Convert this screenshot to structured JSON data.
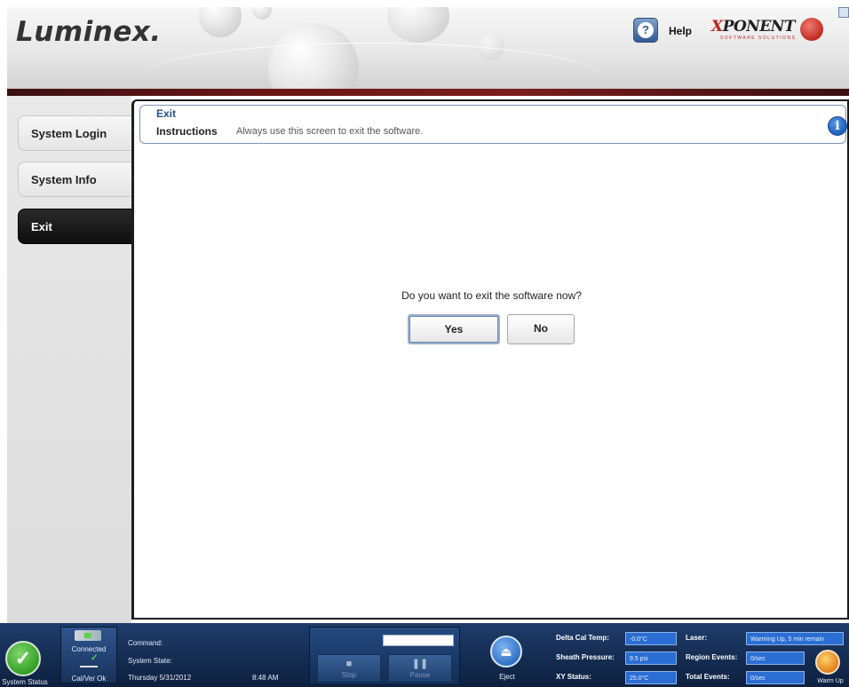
{
  "header": {
    "logo": "Luminex",
    "logo_dot": ".",
    "help_label": "Help",
    "help_icon": "?",
    "brand_word": "XPONENT",
    "brand_sub": "SOFTWARE SOLUTIONS"
  },
  "sidebar": {
    "items": [
      {
        "label": "System Login",
        "active": false
      },
      {
        "label": "System Info",
        "active": false
      },
      {
        "label": "Exit",
        "active": true
      }
    ]
  },
  "main": {
    "section_title": "Exit",
    "instructions_label": "Instructions",
    "instructions_text": "Always use this screen to exit the software.",
    "info_icon": "i",
    "question": "Do you want to exit the software now?",
    "yes_label": "Yes",
    "no_label": "No"
  },
  "statusbar": {
    "system_status_label": "System Status",
    "connected_label": "Connected",
    "calver_label": "Cal/Ver Ok",
    "command_label": "Command:",
    "system_state_label": "System State:",
    "date": "Thursday 5/31/2012",
    "time": "8:48 AM",
    "stop_label": "Stop",
    "pause_label": "Pause",
    "eject_label": "Eject",
    "warmup_label": "Warm Up",
    "readouts": {
      "delta_cal_temp": {
        "label": "Delta Cal Temp:",
        "value": "-0.0°C"
      },
      "sheath_pressure": {
        "label": "Sheath Pressure:",
        "value": "9.5 psi"
      },
      "xy_status": {
        "label": "XY Status:",
        "value": "25.0°C"
      },
      "laser": {
        "label": "Laser:",
        "value": "Warming Up, 5 min remain"
      },
      "region_events": {
        "label": "Region Events:",
        "value": "0/sec"
      },
      "total_events": {
        "label": "Total Events:",
        "value": "0/sec"
      }
    }
  },
  "colors": {
    "accent_blue": "#24518f",
    "statusbar_bg": "#1f3c6a",
    "nav_active_bg": "#111111",
    "status_ok_green": "#2f9a22",
    "header_rule": "#6b1616"
  },
  "icons": [
    "help-icon",
    "xponent-logo-icon",
    "info-icon",
    "system-status-check-icon",
    "connected-icon",
    "calver-icon",
    "stop-icon",
    "pause-icon",
    "eject-icon",
    "warm-up-icon"
  ]
}
